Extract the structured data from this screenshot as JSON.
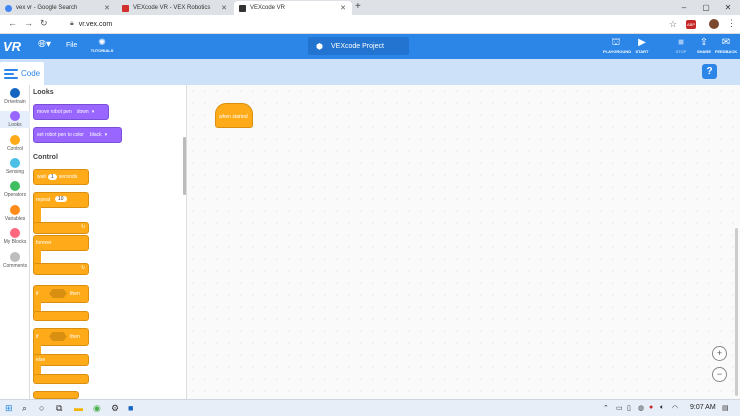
{
  "browser": {
    "tabs": [
      {
        "title": "vex vr - Google Search",
        "color": "#4285f4"
      },
      {
        "title": "VEXcode VR - VEX Robotics",
        "color": "#d32f2f"
      },
      {
        "title": "VEXcode VR",
        "color": "#333333"
      }
    ],
    "new_tab": "+",
    "window_controls": [
      "–",
      "▢",
      "✕"
    ],
    "url": "vr.vex.com",
    "ext_badge": "ABP"
  },
  "app": {
    "logo": "VR",
    "file_menu": "File",
    "tutorials_label": "TUTORIALS",
    "project_name": "VEXcode Project",
    "buttons": {
      "playground": "PLAYGROUND",
      "start": "START",
      "stop": "STOP",
      "share": "SHARE",
      "feedback": "FEEDBACK"
    },
    "code_tab": "Code",
    "help": "?"
  },
  "categories": [
    {
      "label": "Drivetrain",
      "color": "#1565c0"
    },
    {
      "label": "Looks",
      "color": "#9966ff"
    },
    {
      "label": "Control",
      "color": "#ffab19"
    },
    {
      "label": "Sensing",
      "color": "#4cbfe6"
    },
    {
      "label": "Operators",
      "color": "#3fbf5f"
    },
    {
      "label": "Variables",
      "color": "#ff8c1a"
    },
    {
      "label": "My Blocks",
      "color": "#ff6680"
    },
    {
      "label": "Comments",
      "color": "#bdbdbd"
    }
  ],
  "palette": {
    "looks_title": "Looks",
    "move_pen": {
      "text": "move robot pen",
      "value": "down"
    },
    "pen_color": {
      "text": "set robot pen to color",
      "value": "black"
    },
    "control_title": "Control",
    "wait": {
      "text": "wait",
      "value": "1",
      "unit": "seconds"
    },
    "repeat": {
      "text": "repeat",
      "value": "10"
    },
    "forever": "forever",
    "if_then": {
      "if": "if",
      "then": "then"
    },
    "if_else": {
      "if": "if",
      "then": "then",
      "else": "else"
    }
  },
  "workspace": {
    "hat_block": "when started"
  },
  "zoom": {
    "in": "+",
    "out": "−"
  },
  "taskbar": {
    "time": "9:07 AM"
  }
}
